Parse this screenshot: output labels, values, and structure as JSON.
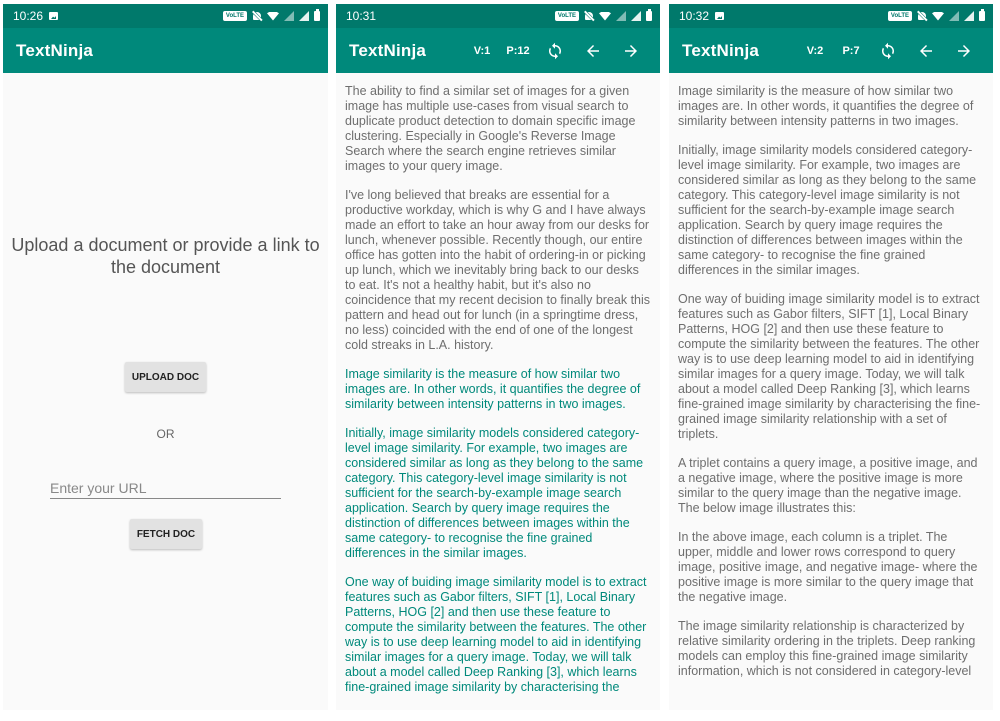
{
  "app_title": "TextNinja",
  "screens": [
    {
      "status": {
        "time": "10:26"
      },
      "prompt": "Upload a document or provide a link to the document",
      "upload_label": "UPLOAD DOC",
      "or_label": "OR",
      "url_placeholder": "Enter your URL",
      "url_value": "",
      "fetch_label": "FETCH DOC"
    },
    {
      "status": {
        "time": "10:31"
      },
      "version": "V:1",
      "pages": "P:12",
      "paragraphs": [
        {
          "text": "The ability to find a similar set of images for a given image has multiple use-cases from visual search to duplicate product detection to domain specific image clustering. Especially in Google's Reverse Image Search where the search engine retrieves similar images to your query image.",
          "highlight": false
        },
        {
          "text": "I've long believed that breaks are essential for a productive workday, which is why G and I have always made an effort to take an hour away from our desks for lunch, whenever possible. Recently though, our entire office has gotten into the habit of ordering-in or picking up lunch, which we inevitably bring back to our desks to eat. It's not a healthy habit, but it's also no coincidence that my recent decision to finally break this pattern and head out for lunch (in a springtime dress, no less) coincided with the end of one of the longest cold streaks in L.A. history.",
          "highlight": false
        },
        {
          "text": "Image similarity is the measure of how similar two images are. In other words, it quantifies the degree of similarity between intensity patterns in two images.",
          "highlight": true
        },
        {
          "text": "Initially, image similarity models considered category-level image similarity. For example, two images are considered similar as long as they belong to the same category. This category-level image similarity is not sufficient for the search-by-example image search application. Search by query image requires the distinction of differences between images within the same category- to recognise the fine grained differences in the similar images.",
          "highlight": true
        },
        {
          "text": "One way of buiding image similarity model is to extract features such as Gabor filters, SIFT [1], Local Binary Patterns, HOG [2] and then use these feature to compute the similarity between the features. The other way is to use deep learning model to aid in identifying similar images for a query image. Today, we will talk about a model called Deep Ranking [3], which learns fine-grained image similarity by characterising the",
          "highlight": true
        }
      ]
    },
    {
      "status": {
        "time": "10:32"
      },
      "version": "V:2",
      "pages": "P:7",
      "paragraphs": [
        {
          "text": "Image similarity is the measure of how similar two images are. In other words, it quantifies the degree of similarity between intensity patterns in two images."
        },
        {
          "text": "Initially, image similarity models considered category-level image similarity. For example, two images are considered similar as long as they belong to the same category. This category-level image similarity is not sufficient for the search-by-example image search application. Search by query image requires the distinction of differences between images within the same category- to recognise the fine grained differences in the similar images."
        },
        {
          "text": "One way of buiding image similarity model is to extract features such as Gabor filters, SIFT [1], Local Binary Patterns, HOG [2] and then use these feature to compute the similarity between the features. The other way is to use deep learning model to aid in identifying similar images for a query image. Today, we will talk about a model called Deep Ranking [3], which learns fine-grained image similarity by characterising the fine-grained image similarity relationship with a set of triplets."
        },
        {
          "text": "A triplet contains a query image, a positive image, and a negative image, where the positive image is more similar to the query image than the negative image. The below image illustrates this:"
        },
        {
          "text": "In the above image, each column is a triplet. The upper, middle and lower rows correspond to query image, positive image, and negative image- where the positive image is more similar to the query image that the negative image."
        },
        {
          "text": "The image similarity relationship is characterized by relative similarity ordering in the triplets. Deep ranking models can employ this fine-grained image similarity information, which is not considered in category-level"
        }
      ]
    }
  ],
  "icons": {
    "refresh": "refresh-icon",
    "back": "arrow-left-icon",
    "forward": "arrow-right-icon"
  },
  "colors": {
    "status_bar": "#00796b",
    "app_bar": "#00897b",
    "highlight_text": "#00897b",
    "body_text": "#6e6e6e"
  }
}
